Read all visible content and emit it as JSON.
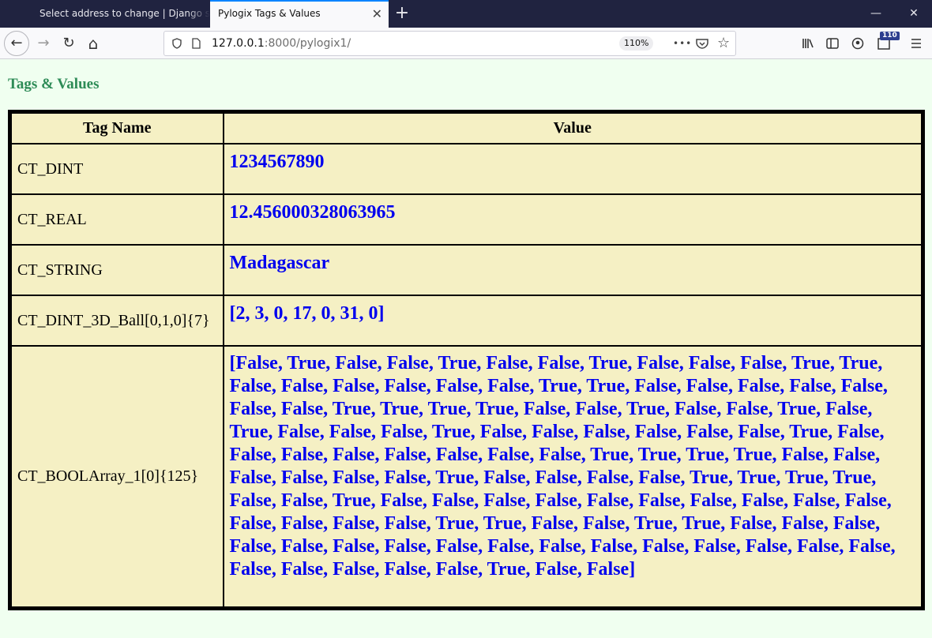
{
  "browser": {
    "tabs": [
      {
        "title": "Select address to change | Django s",
        "active": false
      },
      {
        "title": "Pylogix Tags & Values",
        "active": true
      }
    ],
    "url_host": "127.0.0.1",
    "url_rest": ":8000/pylogix1/",
    "zoom": "110%",
    "extensions_badge": "110",
    "icons": {
      "new_tab": "+",
      "minimize": "—",
      "maximize": "☐",
      "close": "✕",
      "back": "←",
      "forward": "→",
      "reload": "↻",
      "home": "⌂",
      "more": "•••",
      "star": "☆"
    }
  },
  "page": {
    "heading": "Tags & Values",
    "table": {
      "headers": {
        "tag": "Tag Name",
        "value": "Value"
      },
      "rows": [
        {
          "tag": "CT_DINT",
          "value": "1234567890"
        },
        {
          "tag": "CT_REAL",
          "value": "12.456000328063965"
        },
        {
          "tag": "CT_STRING",
          "value": "Madagascar"
        },
        {
          "tag": "CT_DINT_3D_Ball[0,1,0]{7}",
          "value": "[2, 3, 0, 17, 0, 31, 0]"
        },
        {
          "tag": "CT_BOOLArray_1[0]{125}",
          "value": "[False, True, False, False, True, False, False, True, False, False, False, True, True, False, False, False, False, False, False, True, True, False, False, False, False, False, False, False, True, True, True, True, False, False, True, False, False, True, False, True, False, False, False, True, False, False, False, False, False, False, True, False, False, False, False, False, False, False, False, True, True, True, True, False, False, False, False, False, False, True, False, False, False, False, True, True, True, True, False, False, True, False, False, False, False, False, False, False, False, False, False, False, False, False, False, True, True, False, False, True, True, False, False, False, False, False, False, False, False, False, False, False, False, False, False, False, False, False, False, False, False, False, True, False, False]"
        }
      ]
    }
  }
}
